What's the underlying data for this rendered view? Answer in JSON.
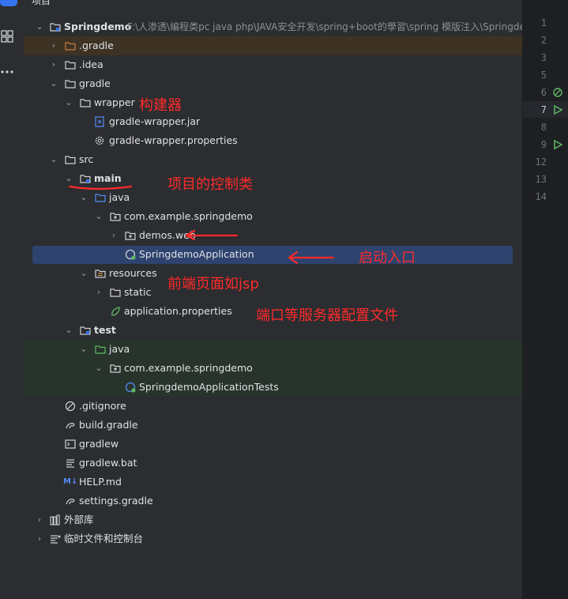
{
  "header": {
    "title": "项目"
  },
  "tree": {
    "root": {
      "label": "Springdemo",
      "path": "F:\\人渗透\\编程类pc java php\\JAVA安全开发\\spring+boot的學習\\spring 模版注入\\Springdemo"
    },
    "items": [
      {
        "label": ".gradle"
      },
      {
        "label": ".idea"
      },
      {
        "label": "gradle"
      },
      {
        "label": "wrapper"
      },
      {
        "label": "gradle-wrapper.jar"
      },
      {
        "label": "gradle-wrapper.properties"
      },
      {
        "label": "src"
      },
      {
        "label": "main"
      },
      {
        "label": "java"
      },
      {
        "label": "com.example.springdemo"
      },
      {
        "label": "demos.web"
      },
      {
        "label": "SpringdemoApplication"
      },
      {
        "label": "resources"
      },
      {
        "label": "static"
      },
      {
        "label": "application.properties"
      },
      {
        "label": "test"
      },
      {
        "label": "java"
      },
      {
        "label": "com.example.springdemo"
      },
      {
        "label": "SpringdemoApplicationTests"
      },
      {
        "label": ".gitignore"
      },
      {
        "label": "build.gradle"
      },
      {
        "label": "gradlew"
      },
      {
        "label": "gradlew.bat"
      },
      {
        "label": "HELP.md"
      },
      {
        "label": "settings.gradle"
      },
      {
        "label": "外部库"
      },
      {
        "label": "临时文件和控制台"
      }
    ]
  },
  "annotations": {
    "wrapper": "构建器",
    "main": "项目的控制类",
    "entry": "启动入口",
    "resources": "前端页面如jsp",
    "properties": "端口等服务器配置文件"
  },
  "gutter": {
    "line_numbers": [
      "1",
      "2",
      "3",
      "5",
      "6",
      "7",
      "8",
      "9",
      "12",
      "13",
      "14"
    ]
  },
  "colors": {
    "selected_row": "#2e436e",
    "excluded_band": "#3d3223",
    "test_band": "#28342b",
    "annotation": "#ff2a2a"
  }
}
